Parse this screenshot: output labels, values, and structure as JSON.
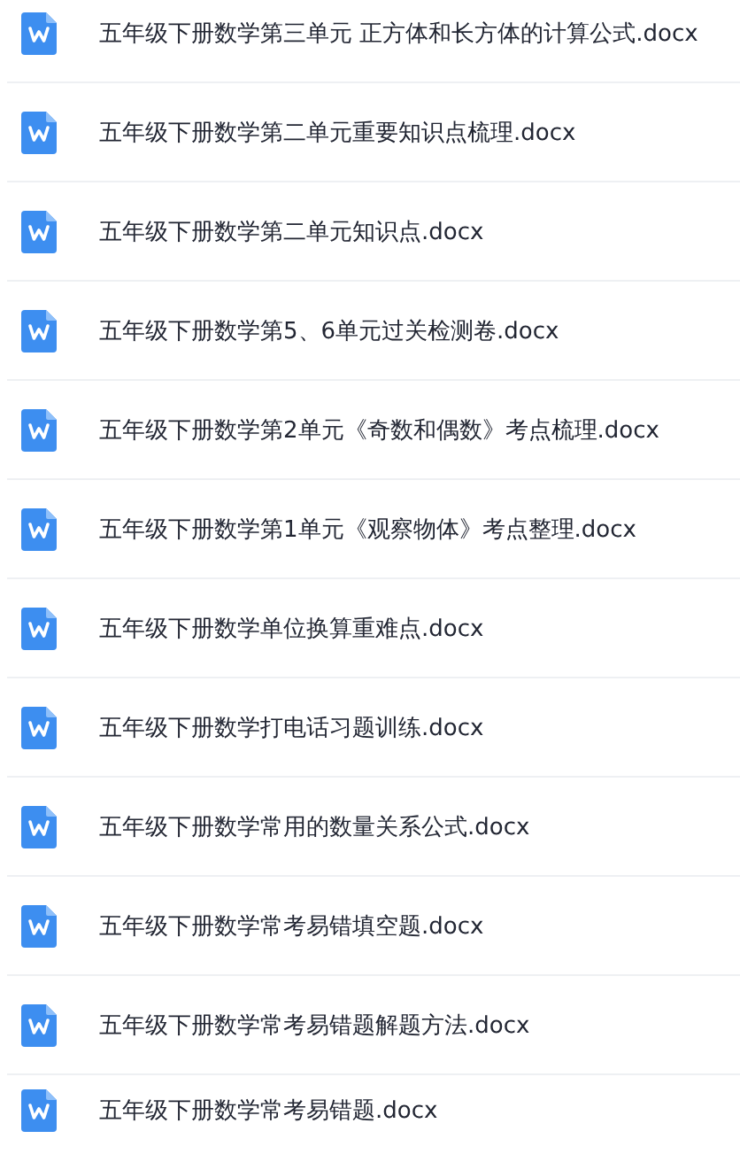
{
  "files": [
    {
      "name": "五年级下册数学第三单元 正方体和长方体的计算公式.docx"
    },
    {
      "name": "五年级下册数学第二单元重要知识点梳理.docx"
    },
    {
      "name": "五年级下册数学第二单元知识点.docx"
    },
    {
      "name": "五年级下册数学第5、6单元过关检测卷.docx"
    },
    {
      "name": "五年级下册数学第2单元《奇数和偶数》考点梳理.docx"
    },
    {
      "name": "五年级下册数学第1单元《观察物体》考点整理.docx"
    },
    {
      "name": "五年级下册数学单位换算重难点.docx"
    },
    {
      "name": "五年级下册数学打电话习题训练.docx"
    },
    {
      "name": "五年级下册数学常用的数量关系公式.docx"
    },
    {
      "name": "五年级下册数学常考易错填空题.docx"
    },
    {
      "name": "五年级下册数学常考易错题解题方法.docx"
    },
    {
      "name": "五年级下册数学常考易错题.docx"
    }
  ]
}
